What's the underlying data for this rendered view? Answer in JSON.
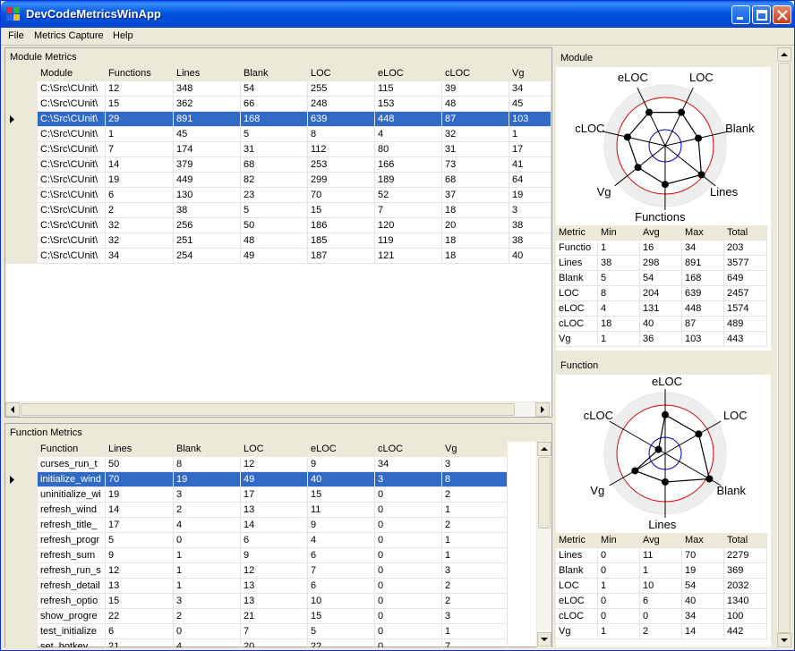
{
  "window": {
    "title": "DevCodeMetricsWinApp"
  },
  "menu": [
    "File",
    "Metrics Capture",
    "Help"
  ],
  "module_panel": {
    "title": "Module Metrics",
    "columns": [
      "Module",
      "Functions",
      "Lines",
      "Blank",
      "LOC",
      "eLOC",
      "cLOC",
      "Vg"
    ],
    "selected_row": 2,
    "rows": [
      [
        "C:\\Src\\CUnit\\",
        "12",
        "348",
        "54",
        "255",
        "115",
        "39",
        "34"
      ],
      [
        "C:\\Src\\CUnit\\",
        "15",
        "362",
        "66",
        "248",
        "153",
        "48",
        "45"
      ],
      [
        "C:\\Src\\CUnit\\",
        "29",
        "891",
        "168",
        "639",
        "448",
        "87",
        "103"
      ],
      [
        "C:\\Src\\CUnit\\",
        "1",
        "45",
        "5",
        "8",
        "4",
        "32",
        "1"
      ],
      [
        "C:\\Src\\CUnit\\",
        "7",
        "174",
        "31",
        "112",
        "80",
        "31",
        "17"
      ],
      [
        "C:\\Src\\CUnit\\",
        "14",
        "379",
        "68",
        "253",
        "166",
        "73",
        "41"
      ],
      [
        "C:\\Src\\CUnit\\",
        "19",
        "449",
        "82",
        "299",
        "189",
        "68",
        "64"
      ],
      [
        "C:\\Src\\CUnit\\",
        "6",
        "130",
        "23",
        "70",
        "52",
        "37",
        "19"
      ],
      [
        "C:\\Src\\CUnit\\",
        "2",
        "38",
        "5",
        "15",
        "7",
        "18",
        "3"
      ],
      [
        "C:\\Src\\CUnit\\",
        "32",
        "256",
        "50",
        "186",
        "120",
        "20",
        "38"
      ],
      [
        "C:\\Src\\CUnit\\",
        "32",
        "251",
        "48",
        "185",
        "119",
        "18",
        "38"
      ],
      [
        "C:\\Src\\CUnit\\",
        "34",
        "254",
        "49",
        "187",
        "121",
        "18",
        "40"
      ]
    ]
  },
  "function_panel": {
    "title": "Function Metrics",
    "columns": [
      "Function",
      "Lines",
      "Blank",
      "LOC",
      "eLOC",
      "cLOC",
      "Vg"
    ],
    "selected_row": 1,
    "rows": [
      [
        "curses_run_t",
        "50",
        "8",
        "12",
        "9",
        "34",
        "3"
      ],
      [
        "initialize_wind",
        "70",
        "19",
        "49",
        "40",
        "3",
        "8"
      ],
      [
        "uninitialize_wi",
        "19",
        "3",
        "17",
        "15",
        "0",
        "2"
      ],
      [
        "refresh_wind",
        "14",
        "2",
        "13",
        "11",
        "0",
        "1"
      ],
      [
        "refresh_title_",
        "17",
        "4",
        "14",
        "9",
        "0",
        "2"
      ],
      [
        "refresh_progr",
        "5",
        "0",
        "6",
        "4",
        "0",
        "1"
      ],
      [
        "refresh_sum",
        "9",
        "1",
        "9",
        "6",
        "0",
        "1"
      ],
      [
        "refresh_run_s",
        "12",
        "1",
        "12",
        "7",
        "0",
        "3"
      ],
      [
        "refresh_detail",
        "13",
        "1",
        "13",
        "6",
        "0",
        "2"
      ],
      [
        "refresh_optio",
        "15",
        "3",
        "13",
        "10",
        "0",
        "2"
      ],
      [
        "show_progre",
        "22",
        "2",
        "21",
        "15",
        "0",
        "3"
      ],
      [
        "test_initialize",
        "6",
        "0",
        "7",
        "5",
        "0",
        "1"
      ],
      [
        "set_hotkey",
        "21",
        "4",
        "20",
        "22",
        "0",
        "7"
      ]
    ]
  },
  "module_chart": {
    "title": "Module",
    "axes": [
      "LOC",
      "Blank",
      "Lines",
      "Functions",
      "Vg",
      "cLOC",
      "eLOC"
    ],
    "value_fraction": [
      0.48,
      0.44,
      0.6,
      0.5,
      0.45,
      0.5,
      0.48
    ],
    "stats_columns": [
      "Metric",
      "Min",
      "Avg",
      "Max",
      "Total"
    ],
    "stats": [
      [
        "Functio",
        "1",
        "16",
        "34",
        "203"
      ],
      [
        "Lines",
        "38",
        "298",
        "891",
        "3577"
      ],
      [
        "Blank",
        "5",
        "54",
        "168",
        "649"
      ],
      [
        "LOC",
        "8",
        "204",
        "639",
        "2457"
      ],
      [
        "eLOC",
        "4",
        "131",
        "448",
        "1574"
      ],
      [
        "cLOC",
        "18",
        "40",
        "87",
        "489"
      ],
      [
        "Vg",
        "1",
        "36",
        "103",
        "443"
      ]
    ]
  },
  "function_chart": {
    "title": "Function",
    "axes": [
      "eLOC",
      "LOC",
      "Blank",
      "Lines",
      "Vg",
      "cLOC"
    ],
    "value_fraction": [
      0.5,
      0.5,
      0.66,
      0.37,
      0.45,
      0.1
    ],
    "stats_columns": [
      "Metric",
      "Min",
      "Avg",
      "Max",
      "Total"
    ],
    "stats": [
      [
        "Lines",
        "0",
        "11",
        "70",
        "2279"
      ],
      [
        "Blank",
        "0",
        "1",
        "19",
        "369"
      ],
      [
        "LOC",
        "1",
        "10",
        "54",
        "2032"
      ],
      [
        "eLOC",
        "0",
        "6",
        "40",
        "1340"
      ],
      [
        "cLOC",
        "0",
        "0",
        "34",
        "100"
      ],
      [
        "Vg",
        "1",
        "2",
        "14",
        "442"
      ]
    ]
  },
  "colors": {
    "selection": "#316ac5",
    "titlebar": "#0054e3",
    "ring_outer": "#dd0000",
    "ring_inner": "#0000cc"
  }
}
